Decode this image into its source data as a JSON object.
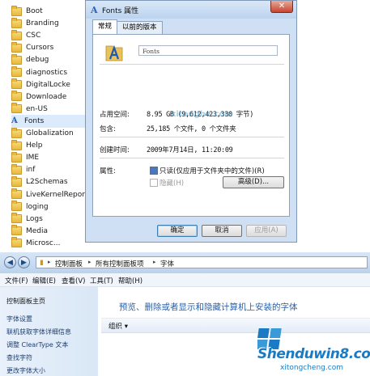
{
  "tree": {
    "items": [
      {
        "label": "Boot"
      },
      {
        "label": "Branding"
      },
      {
        "label": "CSC"
      },
      {
        "label": "Cursors"
      },
      {
        "label": "debug"
      },
      {
        "label": "diagnostics"
      },
      {
        "label": "DigitalLocke"
      },
      {
        "label": "Downloade"
      },
      {
        "label": "en-US"
      },
      {
        "label": "Fonts"
      },
      {
        "label": "Globalization"
      },
      {
        "label": "Help"
      },
      {
        "label": "IME"
      },
      {
        "label": "inf"
      },
      {
        "label": "L2Schemas"
      },
      {
        "label": "LiveKernelReports"
      },
      {
        "label": "loging"
      },
      {
        "label": "Logs"
      },
      {
        "label": "Media"
      },
      {
        "label": "Microsc..."
      }
    ],
    "selected": "Fonts"
  },
  "dialog": {
    "title": "Fonts 属性",
    "close_glyph": "✕",
    "tabs": [
      "常规",
      "以前的版本"
    ],
    "active_tab": "常规",
    "name_value": "Fonts",
    "size_on_disk_label": "占用空间:",
    "size_on_disk_value": "8.95 GB (9,612,423,330 字节)",
    "contains_label": "包含:",
    "contains_value": "25,185 个文件, 0 个文件夹",
    "created_label": "创建时间:",
    "created_value": "2009年7月14日, 11:20:09",
    "attributes_label": "属性:",
    "readonly_label": "只读(仅应用于文件夹中的文件)(R)",
    "hidden_label": "隐藏(H)",
    "advanced_button": "高级(D)...",
    "ok_button": "确定",
    "cancel_button": "取消",
    "apply_button": "应用(A)"
  },
  "explorer": {
    "breadcrumbs": [
      "控制面板",
      "所有控制面板项",
      "字体"
    ],
    "menu": [
      "文件(F)",
      "编辑(E)",
      "查看(V)",
      "工具(T)",
      "帮助(H)"
    ],
    "side_links": {
      "home": "控制面板主页",
      "items": [
        "字体设置",
        "联机获取字体详细信息",
        "调整 ClearType 文本",
        "查找字符",
        "更改字体大小"
      ]
    },
    "heading": "预览、删除或者显示和隐藏计算机上安装的字体",
    "organize_label": "组织 ▾"
  },
  "watermarks": {
    "dialog": "xitonghe.com",
    "big": "Shenduwin8.com",
    "small": "xitongcheng.com"
  },
  "colors": {
    "dialog_frame": "#cfe0f4",
    "heading_blue": "#2a5fa8",
    "selection": "#dcebfc"
  }
}
